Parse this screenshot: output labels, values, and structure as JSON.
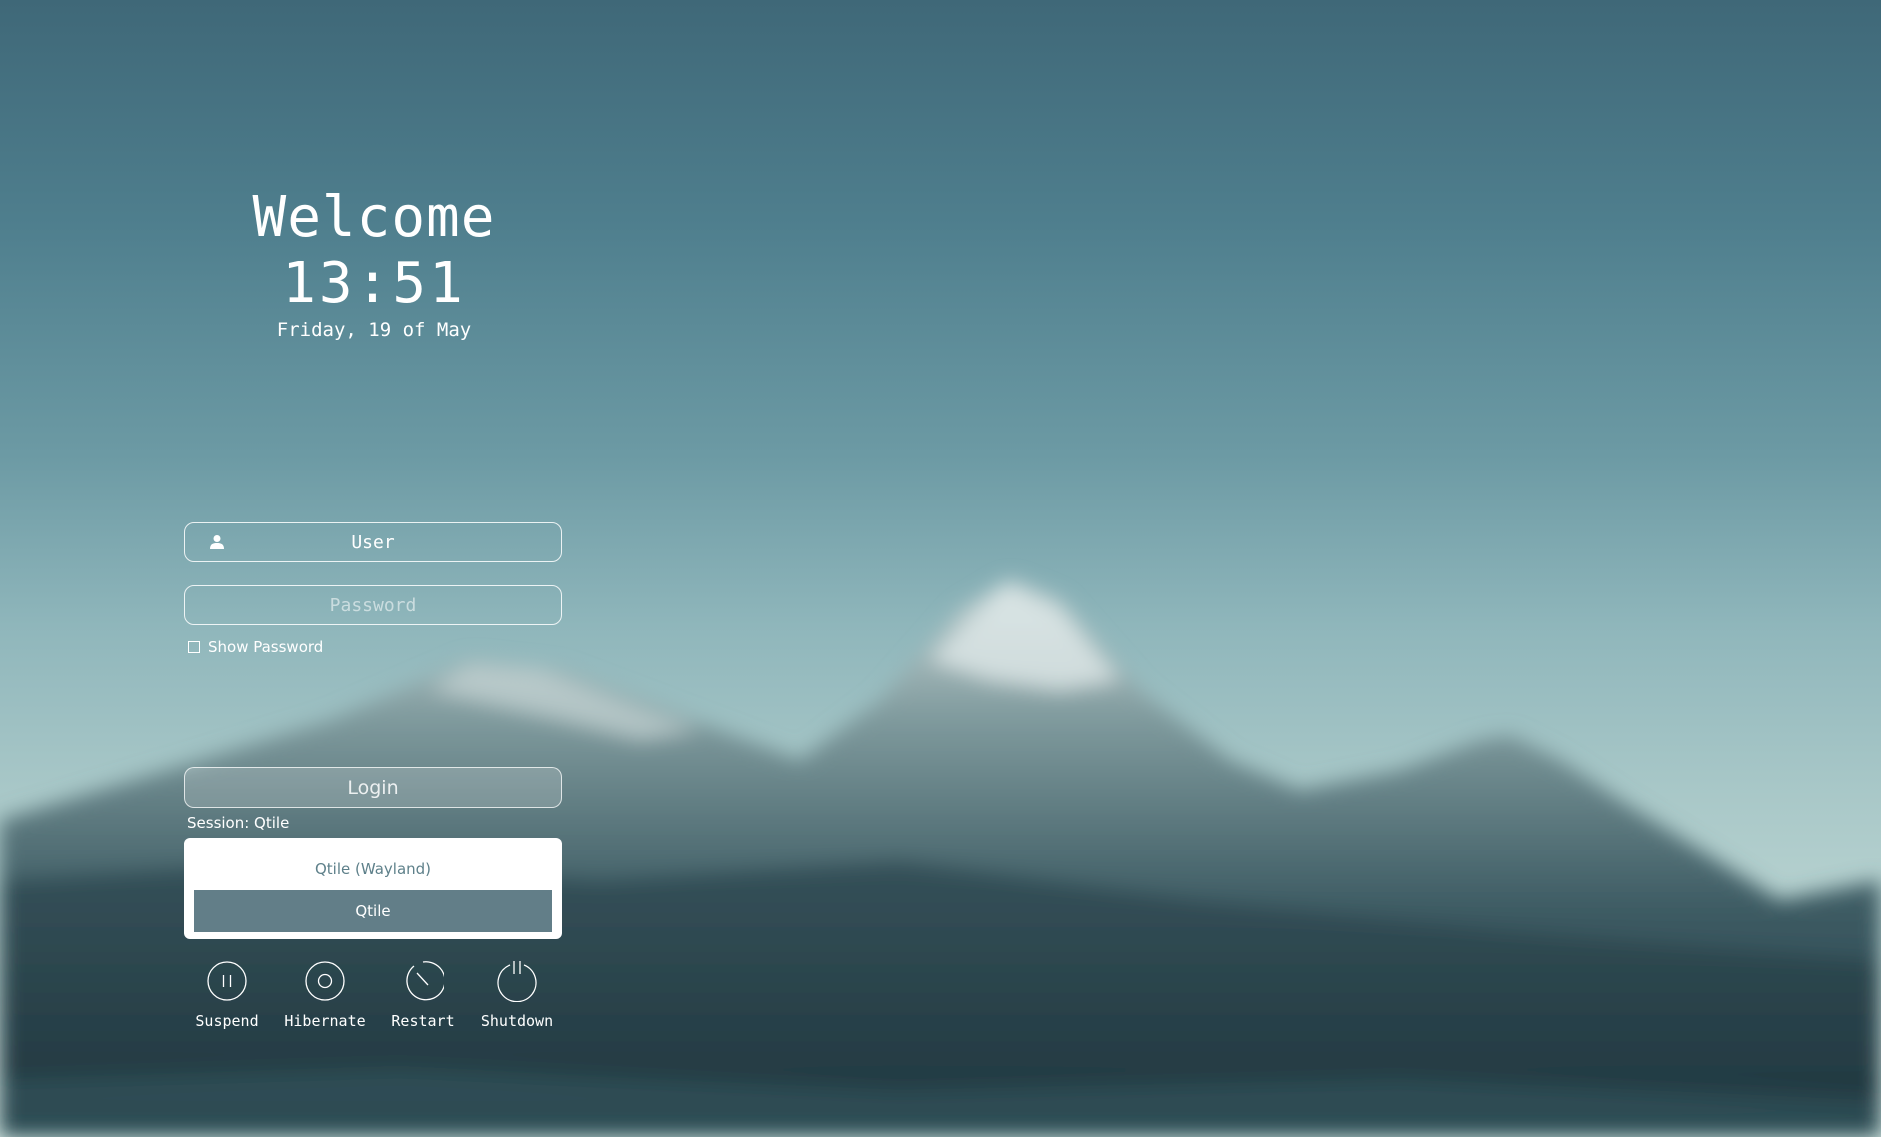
{
  "greeting": {
    "welcome": "Welcome",
    "time": "13:51",
    "date": "Friday, 19 of May"
  },
  "login": {
    "user_value": "User",
    "user_icon": "user-icon",
    "password_placeholder": "Password",
    "show_password_label": "Show Password",
    "show_password_checked": false,
    "login_label": "Login"
  },
  "session": {
    "label": "Session: Qtile",
    "options": [
      {
        "label": "Qtile (Wayland)",
        "selected": false
      },
      {
        "label": "Qtile",
        "selected": true
      }
    ]
  },
  "power_actions": [
    {
      "label": "Suspend",
      "icon": "suspend-icon"
    },
    {
      "label": "Hibernate",
      "icon": "hibernate-icon"
    },
    {
      "label": "Restart",
      "icon": "restart-icon"
    },
    {
      "label": "Shutdown",
      "icon": "shutdown-icon"
    }
  ],
  "colors": {
    "selected_session_bg": "#627e88",
    "menu_text": "#5e808a"
  }
}
